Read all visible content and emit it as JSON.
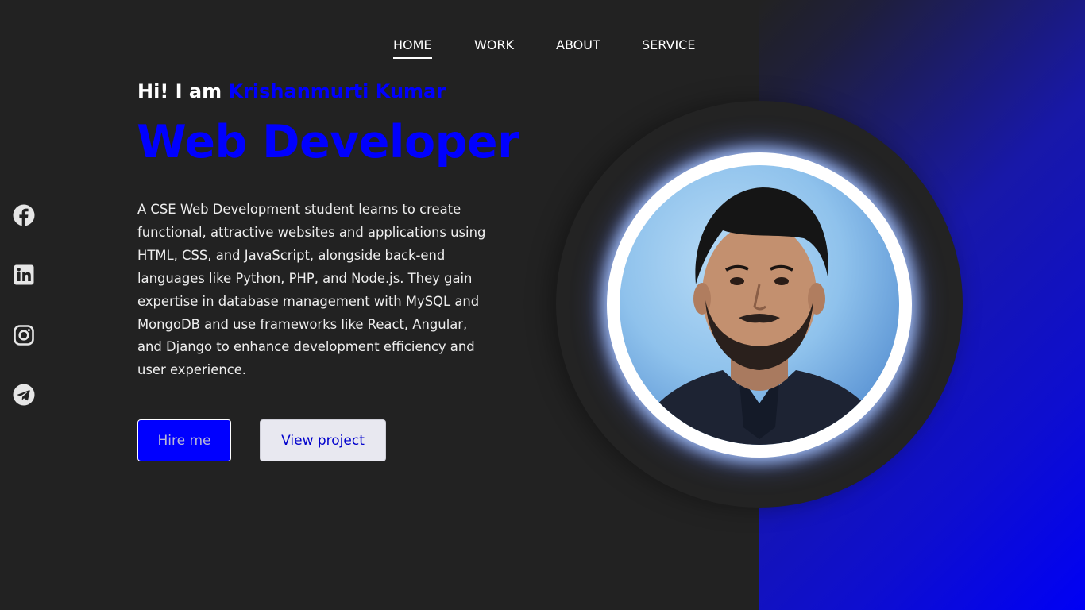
{
  "nav": {
    "items": [
      {
        "label": "HOME",
        "active": true
      },
      {
        "label": "WORK",
        "active": false
      },
      {
        "label": "ABOUT",
        "active": false
      },
      {
        "label": "SERVICE",
        "active": false
      }
    ]
  },
  "social": [
    {
      "icon": "facebook-icon"
    },
    {
      "icon": "linkedin-icon"
    },
    {
      "icon": "instagram-icon"
    },
    {
      "icon": "telegram-icon"
    }
  ],
  "hero": {
    "greeting": "Hi! I am",
    "name": "Krishanmurti Kumar",
    "role": "Web Developer",
    "description": "A CSE Web Development student learns to create functional, attractive websites and applications using HTML, CSS, and JavaScript, alongside back-end languages like Python, PHP, and Node.js. They gain expertise in database management with MySQL and MongoDB and use frameworks like React, Angular, and Django to enhance development efficiency and user experience.",
    "hire_label": "Hire me",
    "view_label": "View project"
  },
  "colors": {
    "background": "#222222",
    "accent": "#0000ff",
    "text": "#ffffff"
  }
}
